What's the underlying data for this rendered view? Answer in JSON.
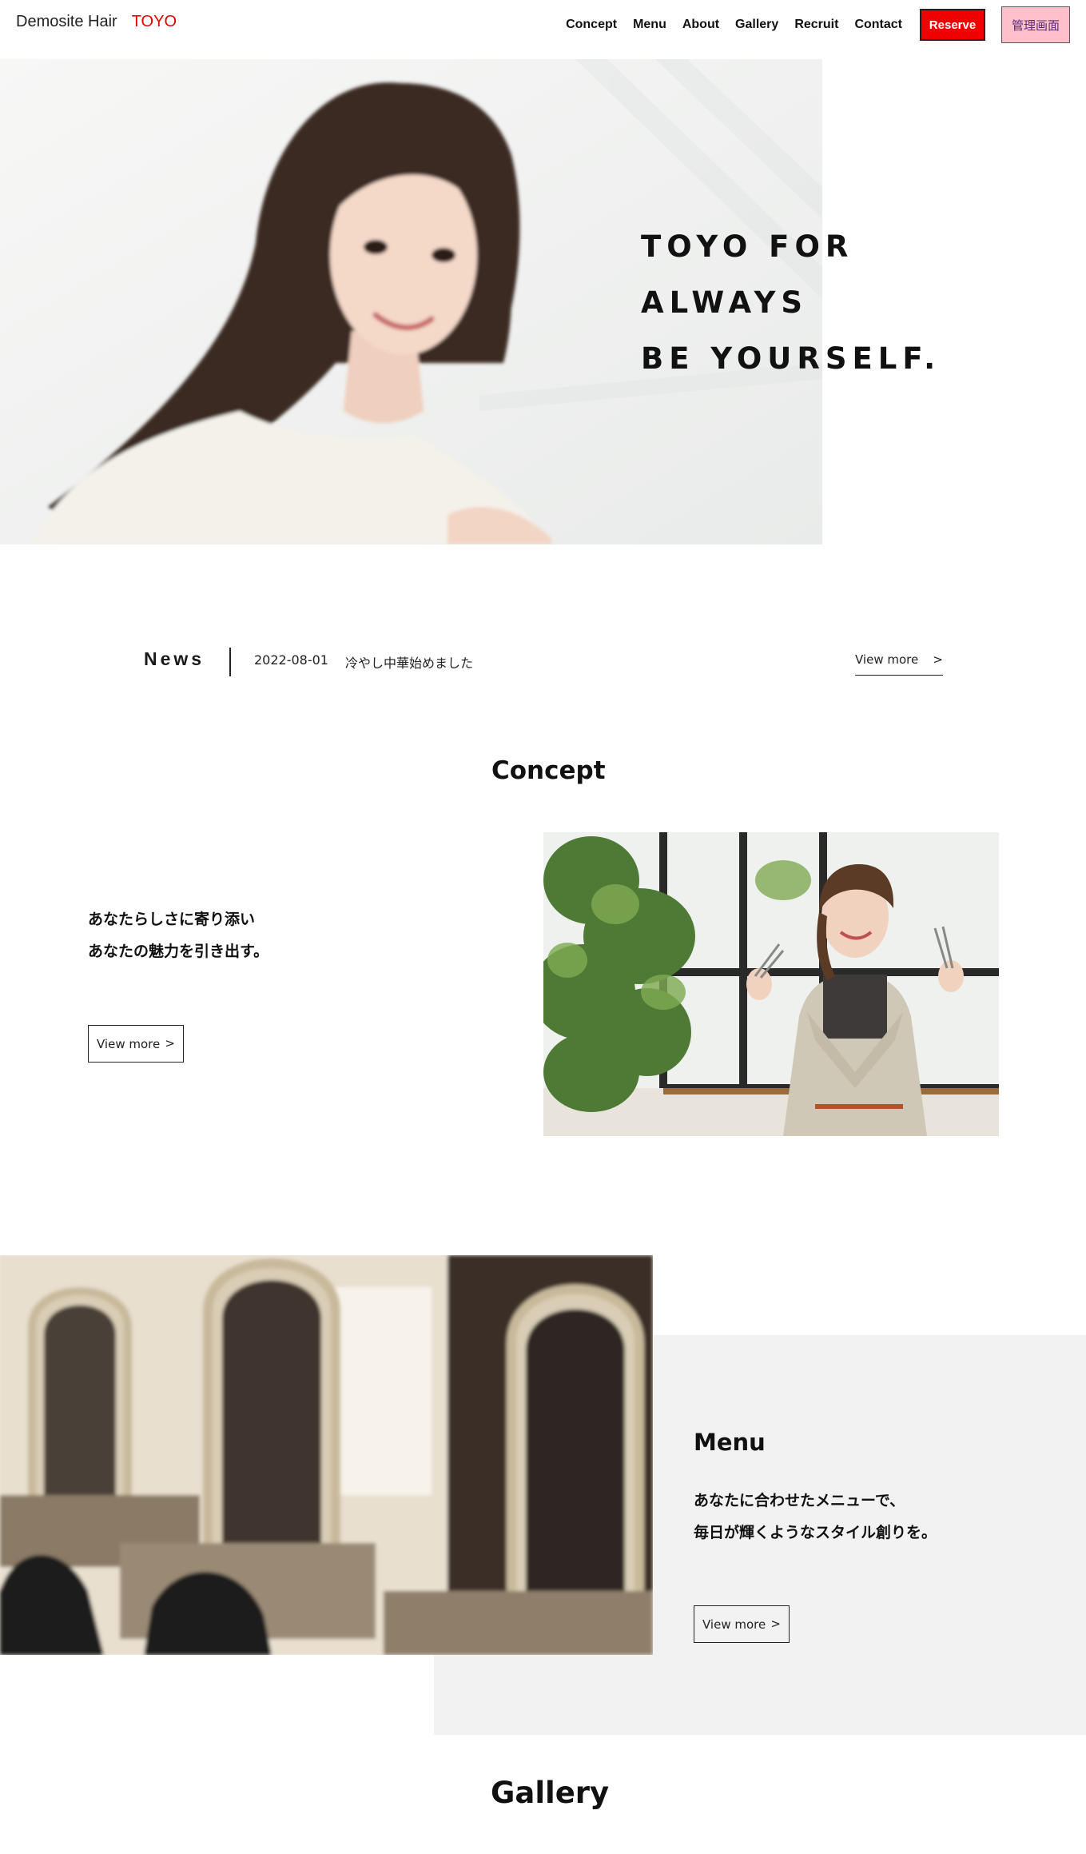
{
  "header": {
    "brand": "Demosite Hair",
    "brand_accent": "TOYO",
    "nav": [
      "Concept",
      "Menu",
      "About",
      "Gallery",
      "Recruit",
      "Contact"
    ],
    "reserve_label": "Reserve",
    "admin_label": "管理画面"
  },
  "hero": {
    "line1": "TOYO FOR",
    "line2": "ALWAYS",
    "line3": "BE YOURSELF."
  },
  "news": {
    "title": "News",
    "date": "2022-08-01",
    "text": "冷やし中華始めました",
    "more_label": "View more",
    "arrow": ">"
  },
  "concept": {
    "heading": "Concept",
    "line1": "あなたらしさに寄り添い",
    "line2": "あなたの魅力を引き出す。",
    "more_label": "View more",
    "arrow": ">"
  },
  "menu": {
    "heading": "Menu",
    "line1": "あなたに合わせたメニューで、",
    "line2": "毎日が輝くようなスタイル創りを。",
    "more_label": "View more",
    "arrow": ">"
  },
  "gallery": {
    "heading": "Gallery"
  },
  "colors": {
    "accent_red": "#e60000",
    "reserve_bg": "#f00000",
    "admin_bg": "#ffc0cb",
    "panel_gray": "#f2f2f2"
  }
}
